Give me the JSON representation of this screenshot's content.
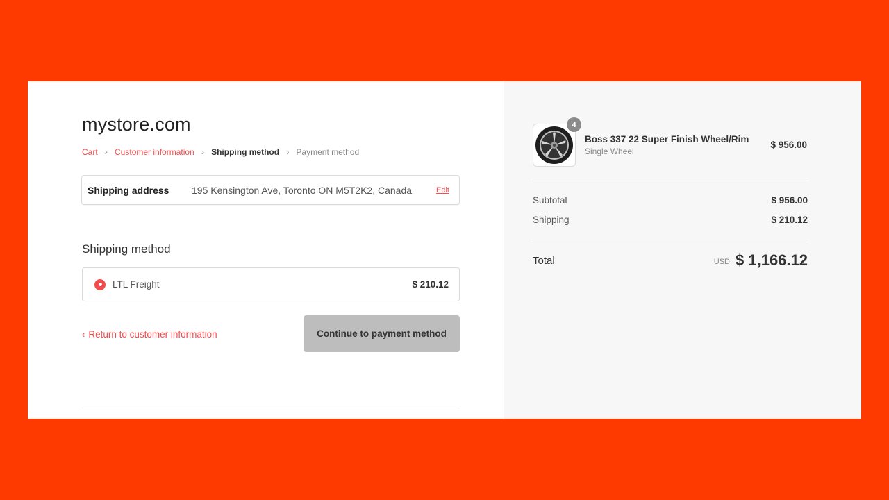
{
  "store": {
    "title": "mystore.com"
  },
  "breadcrumb": [
    {
      "label": "Cart",
      "state": "link"
    },
    {
      "label": "Customer information",
      "state": "link"
    },
    {
      "label": "Shipping method",
      "state": "current"
    },
    {
      "label": "Payment method",
      "state": "upcoming"
    }
  ],
  "shipping_address": {
    "label": "Shipping address",
    "value": "195 Kensington Ave, Toronto ON M5T2K2, Canada",
    "edit_label": "Edit"
  },
  "shipping_method": {
    "heading": "Shipping method",
    "option": {
      "label": "LTL Freight",
      "price": "$ 210.12",
      "selected": true
    }
  },
  "actions": {
    "return_label": "Return to customer information",
    "continue_label": "Continue to payment method"
  },
  "order_summary": {
    "item": {
      "name": "Boss 337 22 Super Finish Wheel/Rim",
      "variant": "Single Wheel",
      "price": "$ 956.00",
      "quantity": "4",
      "icon": "wheel-rim-icon"
    },
    "subtotal_label": "Subtotal",
    "subtotal_value": "$ 956.00",
    "shipping_label": "Shipping",
    "shipping_value": "$ 210.12",
    "total_label": "Total",
    "currency": "USD",
    "total_value": "$ 1,166.12"
  },
  "colors": {
    "background": "#ff3a00",
    "accent": "#f44c4c",
    "button_disabled": "#bdbdbd",
    "sidebar": "#f7f7f7"
  }
}
